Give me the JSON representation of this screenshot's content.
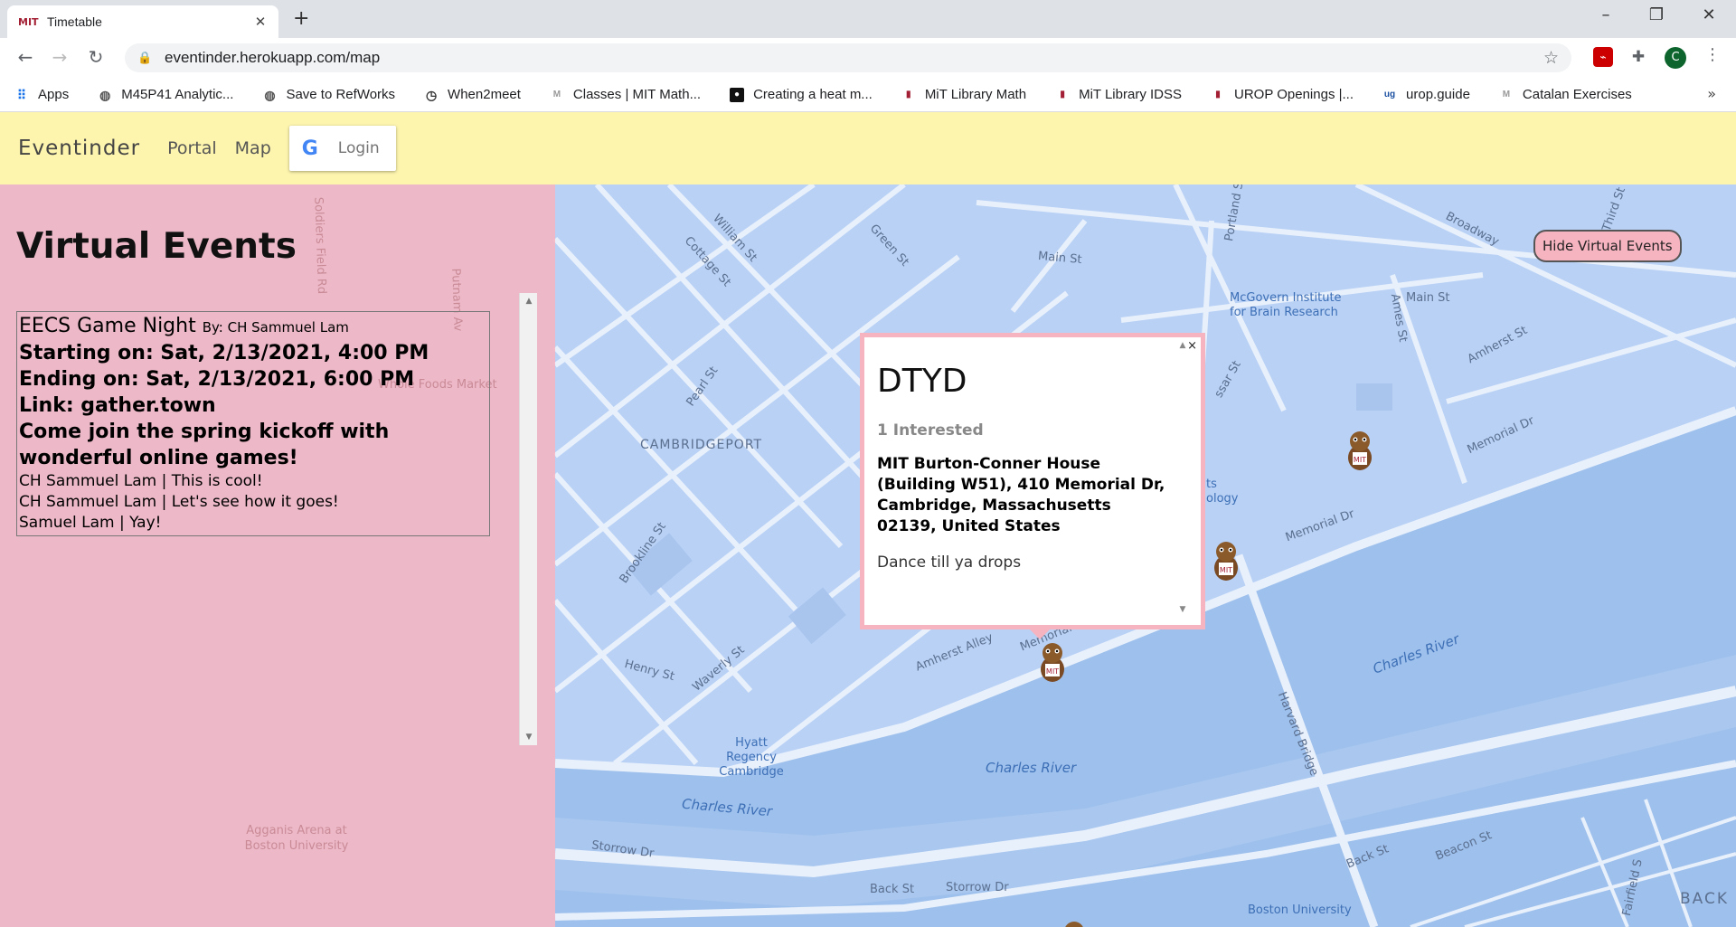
{
  "browser": {
    "tab_title": "Timetable",
    "tab_favicon": "MIT",
    "url": "eventinder.herokuapp.com/map",
    "avatar_letter": "C",
    "bookmarks": [
      {
        "label": "Apps",
        "icon": "apps-grid-icon"
      },
      {
        "label": "M45P41 Analytic...",
        "icon": "globe-icon"
      },
      {
        "label": "Save to RefWorks",
        "icon": "globe-icon"
      },
      {
        "label": "When2meet",
        "icon": "clock-icon"
      },
      {
        "label": "Classes | MIT Math...",
        "icon": "mit-math-icon"
      },
      {
        "label": "Creating a heat m...",
        "icon": "video-icon"
      },
      {
        "label": "MiT Library Math",
        "icon": "mit-icon"
      },
      {
        "label": "MiT Library IDSS",
        "icon": "mit-icon"
      },
      {
        "label": "UROP Openings |...",
        "icon": "mit-icon"
      },
      {
        "label": "urop.guide",
        "icon": "ug-icon"
      },
      {
        "label": "Catalan Exercises",
        "icon": "mit-math-icon"
      }
    ]
  },
  "app": {
    "brand": "Eventinder",
    "nav": [
      "Portal",
      "Map"
    ],
    "login_label": "Login",
    "hide_virtual_label": "Hide Virtual Events"
  },
  "virtual_panel": {
    "title": "Virtual Events",
    "event": {
      "name": "EECS Game Night",
      "by": "By: CH Sammuel Lam",
      "start": "Starting on: Sat, 2/13/2021, 4:00 PM",
      "end": "Ending on: Sat, 2/13/2021, 6:00 PM",
      "link": "Link: gather.town",
      "description": "Come join the spring kickoff with wonderful online games!",
      "comments": [
        "CH Sammuel Lam | This is cool!",
        "CH Sammuel Lam | Let's see how it goes!",
        "Samuel Lam | Yay!"
      ]
    }
  },
  "popup": {
    "title": "DTYD",
    "interested": "1 Interested",
    "address": "MIT Burton-Conner House (Building W51), 410 Memorial Dr, Cambridge, Massachusetts 02139, United States",
    "description": "Dance till ya drops",
    "close": "×"
  },
  "map_labels": {
    "william_st": "William St",
    "cottage_st": "Cottage St",
    "green_st": "Green St",
    "main_st": "Main St",
    "main_st2": "Main St",
    "portland_st": "Portland St",
    "broadway": "Broadway",
    "third_st": "Third St",
    "mcgovern": "McGovern Institute for Brain Research",
    "pearl_st": "Pearl St",
    "cambridgeport": "CAMBRIDGEPORT",
    "brookline_st": "Brookline St",
    "memorial_dr": "Memorial Dr",
    "memorial_dr2": "Memorial Dr",
    "memorial_dr3": "Memorial Dr",
    "amherst_st": "Amherst St",
    "amherst_alley": "Amherst Alley",
    "ames_st": "Ames St",
    "henry_st": "Henry St",
    "waverly_st": "Waverly St",
    "hyatt": "Hyatt Regency Cambridge",
    "charles_river1": "Charles River",
    "charles_river2": "Charles River",
    "charles_river3": "Charles River",
    "harvard_bridge": "Harvard Bridge",
    "storrow_dr": "Storrow Dr",
    "storrow_dr2": "Storrow Dr",
    "back_st": "Back St",
    "back_st2": "Back St",
    "beacon_st": "Beacon St",
    "boston_univ": "Boston University",
    "fairfield": "Fairfield S",
    "ssar_st": "ssar St",
    "technology": "ology",
    "ts": "ts",
    "back": "BACK",
    "soldiers_field": "Soldiers Field Rd",
    "whole_foods": "Whole Foods Market",
    "putnam": "Putnam Av",
    "agganis": "Agganis Arena at Boston University"
  },
  "colors": {
    "nav_bg": "#fdf5ae",
    "panel_bg": "#f6b4c0",
    "map_land": "#b8d1f5",
    "map_water": "#9ec0ec",
    "road": "#e8f0fc"
  }
}
